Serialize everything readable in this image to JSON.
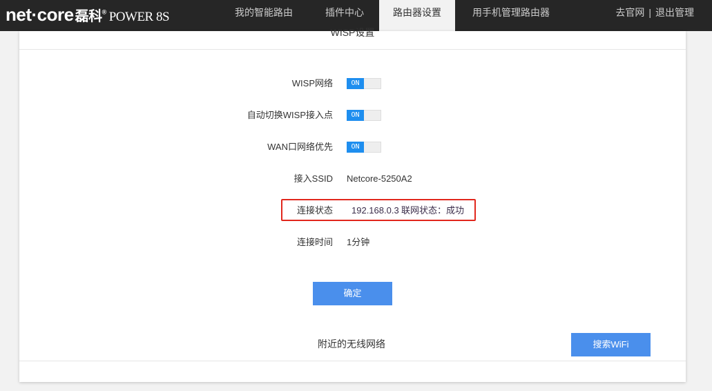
{
  "header": {
    "brand": "net·core",
    "brand_cn": "磊科",
    "reg": "®",
    "model": "POWER 8S",
    "nav": [
      {
        "label": "我的智能路由"
      },
      {
        "label": "插件中心"
      },
      {
        "label": "路由器设置",
        "active": true
      },
      {
        "label": "用手机管理路由器"
      }
    ],
    "links": {
      "official": "去官网",
      "sep": "|",
      "logout": "退出管理"
    }
  },
  "panel": {
    "title": "WISP设置",
    "wisp": {
      "label": "WISP网络",
      "state": "ON"
    },
    "auto_switch": {
      "label": "自动切换WISP接入点",
      "state": "ON"
    },
    "wan_priority": {
      "label": "WAN口网络优先",
      "state": "ON"
    },
    "ssid": {
      "label": "接入SSID",
      "value": "Netcore-5250A2"
    },
    "status": {
      "label": "连接状态",
      "ip": "192.168.0.3",
      "net_status": "联网状态：成功"
    },
    "time": {
      "label": "连接时间",
      "value": "1分钟"
    },
    "confirm": "确定",
    "nearby": "附近的无线网络",
    "search": "搜索WiFi"
  },
  "colors": {
    "accent": "#1e8eef",
    "button": "#4a8fec",
    "highlight": "#e1261c"
  }
}
